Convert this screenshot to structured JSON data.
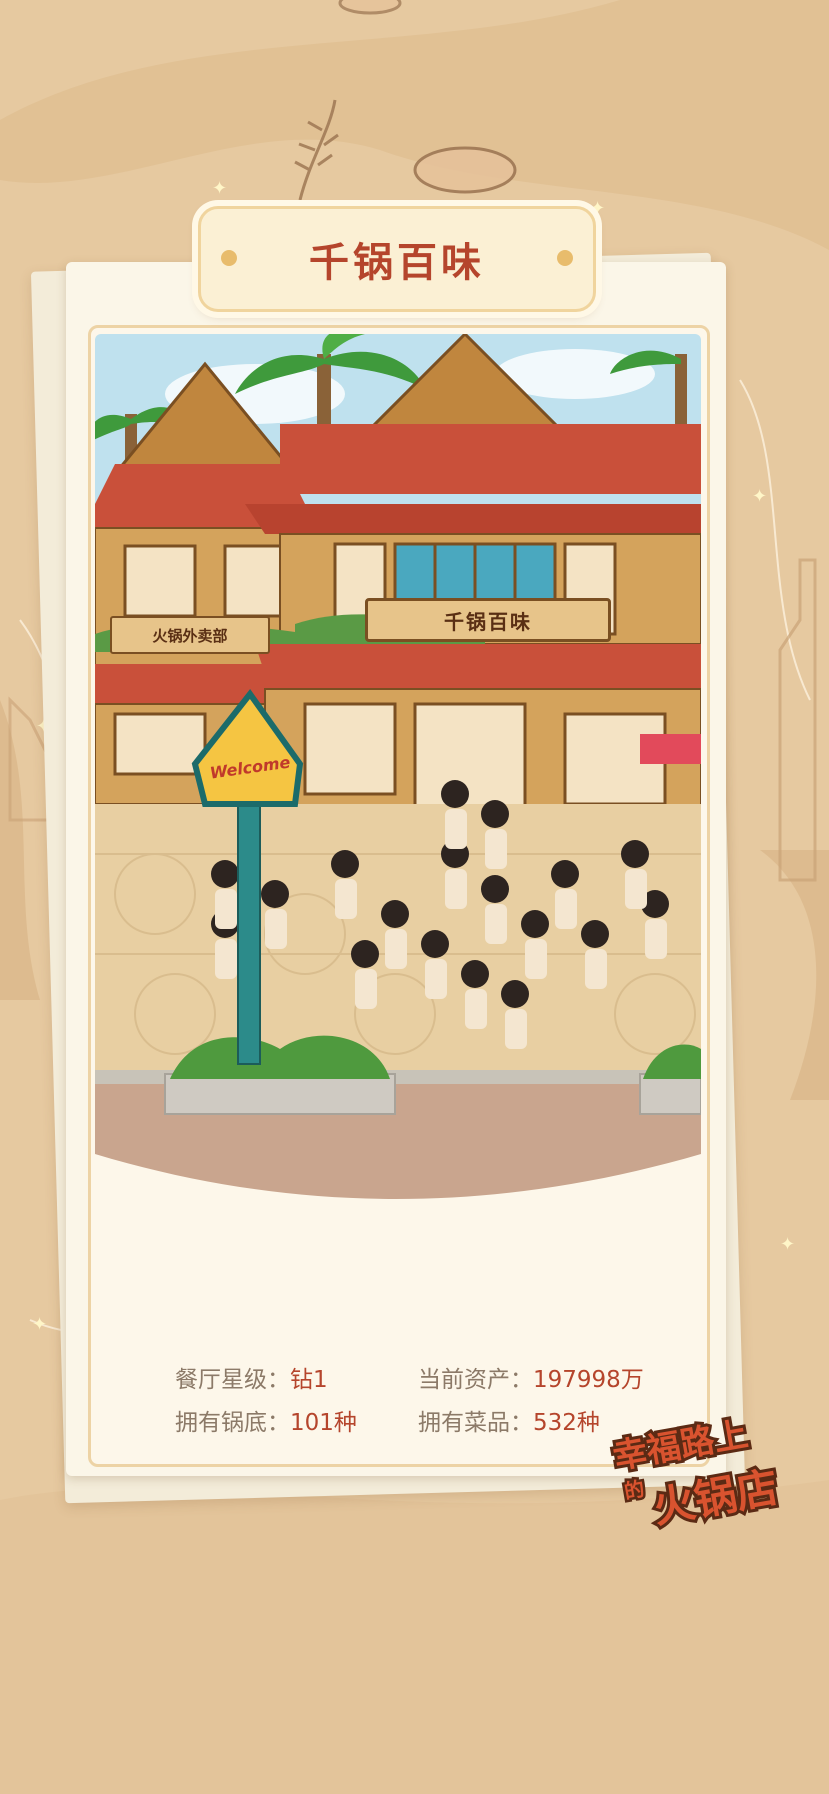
{
  "title": "千锅百味",
  "scene": {
    "restaurant_sign": "千锅百味",
    "takeout_sign": "火锅外卖部",
    "welcome_sign": "Welcome"
  },
  "stats": [
    {
      "label": "餐厅星级：",
      "value": "钻1"
    },
    {
      "label": "当前资产：",
      "value": "197998万"
    },
    {
      "label": "拥有锅底：",
      "value": "101种"
    },
    {
      "label": "拥有菜品：",
      "value": "532种"
    }
  ],
  "logo": {
    "line1": "幸福路上",
    "line2_small": "的",
    "line2": "火锅店"
  },
  "colors": {
    "background": "#e6c9a0",
    "accent_red": "#b5452c",
    "label_gray": "#8c7a68",
    "banner_fill": "#fbf0d4"
  }
}
